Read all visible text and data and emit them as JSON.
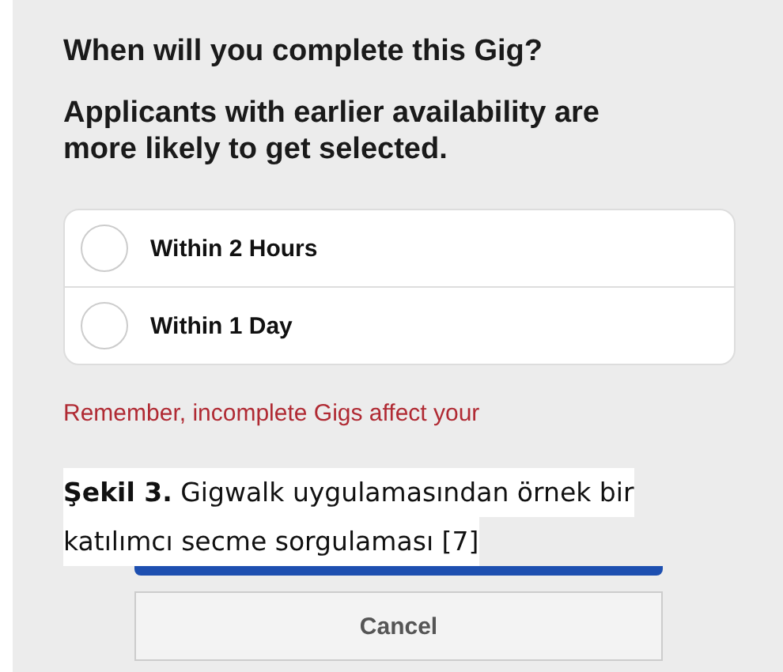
{
  "question": "When will you complete this Gig?",
  "note": "Applicants with earlier availability are more likely to get selected.",
  "options": [
    {
      "label": "Within 2 Hours",
      "selected": false
    },
    {
      "label": "Within 1 Day",
      "selected": false
    }
  ],
  "warning": "Remember, incomplete Gigs affect your",
  "buttons": [
    {
      "kind": "primary"
    },
    {
      "kind": "secondary",
      "label": "Cancel"
    }
  ],
  "caption": [
    "**Şekil 3.** Gigwalk uygulamasından örnek bir",
    "katılımcı secme sorgulaması [7]"
  ]
}
